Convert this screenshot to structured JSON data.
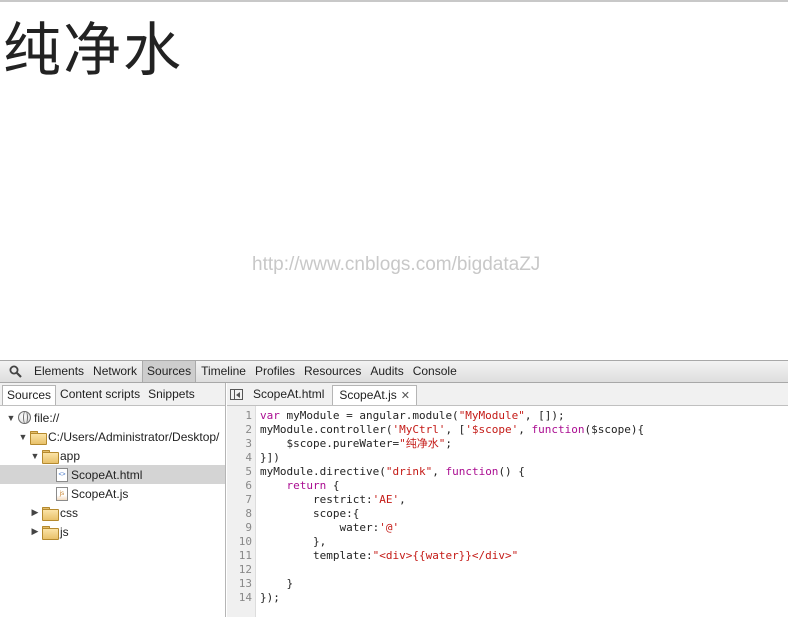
{
  "page": {
    "heading": "纯净水",
    "watermark": "http://www.cnblogs.com/bigdataZJ"
  },
  "devtools": {
    "toolbar": {
      "search_icon": "magnifier-icon",
      "tabs": [
        "Elements",
        "Network",
        "Sources",
        "Timeline",
        "Profiles",
        "Resources",
        "Audits",
        "Console"
      ],
      "selected_tab": "Sources"
    },
    "navigator": {
      "tabs": [
        "Sources",
        "Content scripts",
        "Snippets"
      ],
      "selected_tab": "Sources",
      "tree": [
        {
          "label": "file://",
          "icon": "globe-icon",
          "expanded": true,
          "depth": 0
        },
        {
          "label": "C:/Users/Administrator/Desktop/",
          "icon": "folder-icon",
          "expanded": true,
          "depth": 1
        },
        {
          "label": "app",
          "icon": "folder-icon",
          "expanded": true,
          "depth": 2
        },
        {
          "label": "ScopeAt.html",
          "icon": "html-file-icon",
          "depth": 3,
          "selected": true
        },
        {
          "label": "ScopeAt.js",
          "icon": "js-file-icon",
          "depth": 3
        },
        {
          "label": "css",
          "icon": "folder-icon",
          "expanded": false,
          "depth": 2
        },
        {
          "label": "js",
          "icon": "folder-icon",
          "expanded": false,
          "depth": 2
        }
      ]
    },
    "editor": {
      "tabs": [
        {
          "label": "ScopeAt.html",
          "selected": false
        },
        {
          "label": "ScopeAt.js",
          "selected": true,
          "close": "✕"
        }
      ],
      "line_numbers": [
        "1",
        "2",
        "3",
        "4",
        "5",
        "6",
        "7",
        "8",
        "9",
        "10",
        "11",
        "12",
        "13",
        "14"
      ],
      "code": [
        "var myModule = angular.module(\"MyModule\", []);",
        "myModule.controller('MyCtrl', ['$scope', function($scope){",
        "    $scope.pureWater=\"纯净水\";",
        "}])",
        "myModule.directive(\"drink\", function() {",
        "    return {",
        "        restrict:'AE',",
        "        scope:{",
        "            water:'@'",
        "        },",
        "        template:\"<div>{{water}}</div>\"",
        "",
        "    }",
        "});"
      ]
    }
  }
}
